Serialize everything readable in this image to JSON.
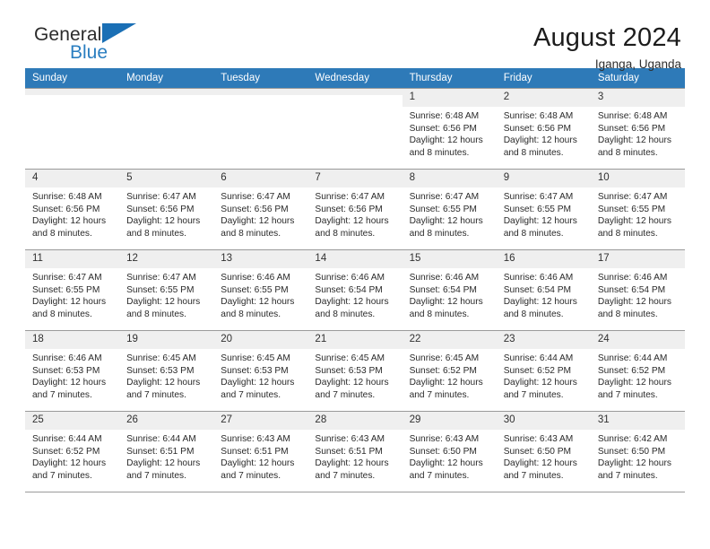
{
  "brand": {
    "name_part1": "General",
    "name_part2": "Blue",
    "triangle_color": "#1a6fb5",
    "text_color": "#2a7ec0"
  },
  "header": {
    "title": "August 2024",
    "subtitle": "Iganga, Uganda"
  },
  "theme": {
    "header_bar": "#2e7ab8",
    "daynum_band": "#efefef",
    "grid_line": "#9a9a9a"
  },
  "weekday_headers": [
    "Sunday",
    "Monday",
    "Tuesday",
    "Wednesday",
    "Thursday",
    "Friday",
    "Saturday"
  ],
  "labels": {
    "sunrise_prefix": "Sunrise:",
    "sunset_prefix": "Sunset:",
    "daylight_prefix": "Daylight:"
  },
  "weeks": [
    [
      {
        "day": "",
        "empty": true
      },
      {
        "day": "",
        "empty": true
      },
      {
        "day": "",
        "empty": true
      },
      {
        "day": "",
        "empty": true
      },
      {
        "day": "1",
        "sunrise": "Sunrise: 6:48 AM",
        "sunset": "Sunset: 6:56 PM",
        "daylight": "Daylight: 12 hours and 8 minutes."
      },
      {
        "day": "2",
        "sunrise": "Sunrise: 6:48 AM",
        "sunset": "Sunset: 6:56 PM",
        "daylight": "Daylight: 12 hours and 8 minutes."
      },
      {
        "day": "3",
        "sunrise": "Sunrise: 6:48 AM",
        "sunset": "Sunset: 6:56 PM",
        "daylight": "Daylight: 12 hours and 8 minutes."
      }
    ],
    [
      {
        "day": "4",
        "sunrise": "Sunrise: 6:48 AM",
        "sunset": "Sunset: 6:56 PM",
        "daylight": "Daylight: 12 hours and 8 minutes."
      },
      {
        "day": "5",
        "sunrise": "Sunrise: 6:47 AM",
        "sunset": "Sunset: 6:56 PM",
        "daylight": "Daylight: 12 hours and 8 minutes."
      },
      {
        "day": "6",
        "sunrise": "Sunrise: 6:47 AM",
        "sunset": "Sunset: 6:56 PM",
        "daylight": "Daylight: 12 hours and 8 minutes."
      },
      {
        "day": "7",
        "sunrise": "Sunrise: 6:47 AM",
        "sunset": "Sunset: 6:56 PM",
        "daylight": "Daylight: 12 hours and 8 minutes."
      },
      {
        "day": "8",
        "sunrise": "Sunrise: 6:47 AM",
        "sunset": "Sunset: 6:55 PM",
        "daylight": "Daylight: 12 hours and 8 minutes."
      },
      {
        "day": "9",
        "sunrise": "Sunrise: 6:47 AM",
        "sunset": "Sunset: 6:55 PM",
        "daylight": "Daylight: 12 hours and 8 minutes."
      },
      {
        "day": "10",
        "sunrise": "Sunrise: 6:47 AM",
        "sunset": "Sunset: 6:55 PM",
        "daylight": "Daylight: 12 hours and 8 minutes."
      }
    ],
    [
      {
        "day": "11",
        "sunrise": "Sunrise: 6:47 AM",
        "sunset": "Sunset: 6:55 PM",
        "daylight": "Daylight: 12 hours and 8 minutes."
      },
      {
        "day": "12",
        "sunrise": "Sunrise: 6:47 AM",
        "sunset": "Sunset: 6:55 PM",
        "daylight": "Daylight: 12 hours and 8 minutes."
      },
      {
        "day": "13",
        "sunrise": "Sunrise: 6:46 AM",
        "sunset": "Sunset: 6:55 PM",
        "daylight": "Daylight: 12 hours and 8 minutes."
      },
      {
        "day": "14",
        "sunrise": "Sunrise: 6:46 AM",
        "sunset": "Sunset: 6:54 PM",
        "daylight": "Daylight: 12 hours and 8 minutes."
      },
      {
        "day": "15",
        "sunrise": "Sunrise: 6:46 AM",
        "sunset": "Sunset: 6:54 PM",
        "daylight": "Daylight: 12 hours and 8 minutes."
      },
      {
        "day": "16",
        "sunrise": "Sunrise: 6:46 AM",
        "sunset": "Sunset: 6:54 PM",
        "daylight": "Daylight: 12 hours and 8 minutes."
      },
      {
        "day": "17",
        "sunrise": "Sunrise: 6:46 AM",
        "sunset": "Sunset: 6:54 PM",
        "daylight": "Daylight: 12 hours and 8 minutes."
      }
    ],
    [
      {
        "day": "18",
        "sunrise": "Sunrise: 6:46 AM",
        "sunset": "Sunset: 6:53 PM",
        "daylight": "Daylight: 12 hours and 7 minutes."
      },
      {
        "day": "19",
        "sunrise": "Sunrise: 6:45 AM",
        "sunset": "Sunset: 6:53 PM",
        "daylight": "Daylight: 12 hours and 7 minutes."
      },
      {
        "day": "20",
        "sunrise": "Sunrise: 6:45 AM",
        "sunset": "Sunset: 6:53 PM",
        "daylight": "Daylight: 12 hours and 7 minutes."
      },
      {
        "day": "21",
        "sunrise": "Sunrise: 6:45 AM",
        "sunset": "Sunset: 6:53 PM",
        "daylight": "Daylight: 12 hours and 7 minutes."
      },
      {
        "day": "22",
        "sunrise": "Sunrise: 6:45 AM",
        "sunset": "Sunset: 6:52 PM",
        "daylight": "Daylight: 12 hours and 7 minutes."
      },
      {
        "day": "23",
        "sunrise": "Sunrise: 6:44 AM",
        "sunset": "Sunset: 6:52 PM",
        "daylight": "Daylight: 12 hours and 7 minutes."
      },
      {
        "day": "24",
        "sunrise": "Sunrise: 6:44 AM",
        "sunset": "Sunset: 6:52 PM",
        "daylight": "Daylight: 12 hours and 7 minutes."
      }
    ],
    [
      {
        "day": "25",
        "sunrise": "Sunrise: 6:44 AM",
        "sunset": "Sunset: 6:52 PM",
        "daylight": "Daylight: 12 hours and 7 minutes."
      },
      {
        "day": "26",
        "sunrise": "Sunrise: 6:44 AM",
        "sunset": "Sunset: 6:51 PM",
        "daylight": "Daylight: 12 hours and 7 minutes."
      },
      {
        "day": "27",
        "sunrise": "Sunrise: 6:43 AM",
        "sunset": "Sunset: 6:51 PM",
        "daylight": "Daylight: 12 hours and 7 minutes."
      },
      {
        "day": "28",
        "sunrise": "Sunrise: 6:43 AM",
        "sunset": "Sunset: 6:51 PM",
        "daylight": "Daylight: 12 hours and 7 minutes."
      },
      {
        "day": "29",
        "sunrise": "Sunrise: 6:43 AM",
        "sunset": "Sunset: 6:50 PM",
        "daylight": "Daylight: 12 hours and 7 minutes."
      },
      {
        "day": "30",
        "sunrise": "Sunrise: 6:43 AM",
        "sunset": "Sunset: 6:50 PM",
        "daylight": "Daylight: 12 hours and 7 minutes."
      },
      {
        "day": "31",
        "sunrise": "Sunrise: 6:42 AM",
        "sunset": "Sunset: 6:50 PM",
        "daylight": "Daylight: 12 hours and 7 minutes."
      }
    ]
  ]
}
